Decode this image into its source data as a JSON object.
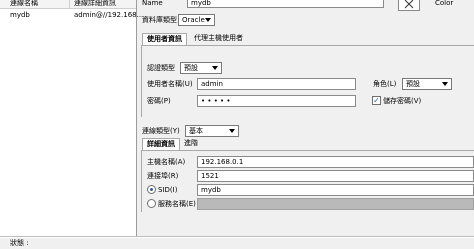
{
  "connection_list": {
    "headers": {
      "name": "連線名稱",
      "detail": "連線詳細資訊"
    },
    "rows": [
      {
        "name": "mydb",
        "detail": "admin@//192.168..."
      }
    ]
  },
  "header": {
    "name_label": "Name",
    "name_value": "mydb",
    "color_label": "Color"
  },
  "db_type": {
    "label": "資料庫類型",
    "value": "Oracle"
  },
  "auth_tabs": {
    "user_info": "使用者資訊",
    "proxy_user": "代理主機使用者"
  },
  "auth": {
    "auth_type_label": "認證類型",
    "auth_type_value": "預設",
    "username_label": "使用者名稱(U)",
    "username_value": "admin",
    "role_label": "角色(L)",
    "role_value": "預設",
    "password_label": "密碼(P)",
    "password_value": "• • • • •",
    "save_password_label": "儲存密碼(V)",
    "save_password_checked": true
  },
  "connection_type": {
    "label": "連線類型(Y)",
    "value": "基本"
  },
  "detail_tabs": {
    "details": "詳細資訊",
    "advanced": "進階"
  },
  "details": {
    "host_label": "主機名稱(A)",
    "host_value": "192.168.0.1",
    "port_label": "連接埠(R)",
    "port_value": "1521",
    "sid_label": "SID(I)",
    "sid_value": "mydb",
    "service_label": "服務名稱(E)",
    "service_value": ""
  },
  "status": {
    "label": "狀態 :"
  }
}
